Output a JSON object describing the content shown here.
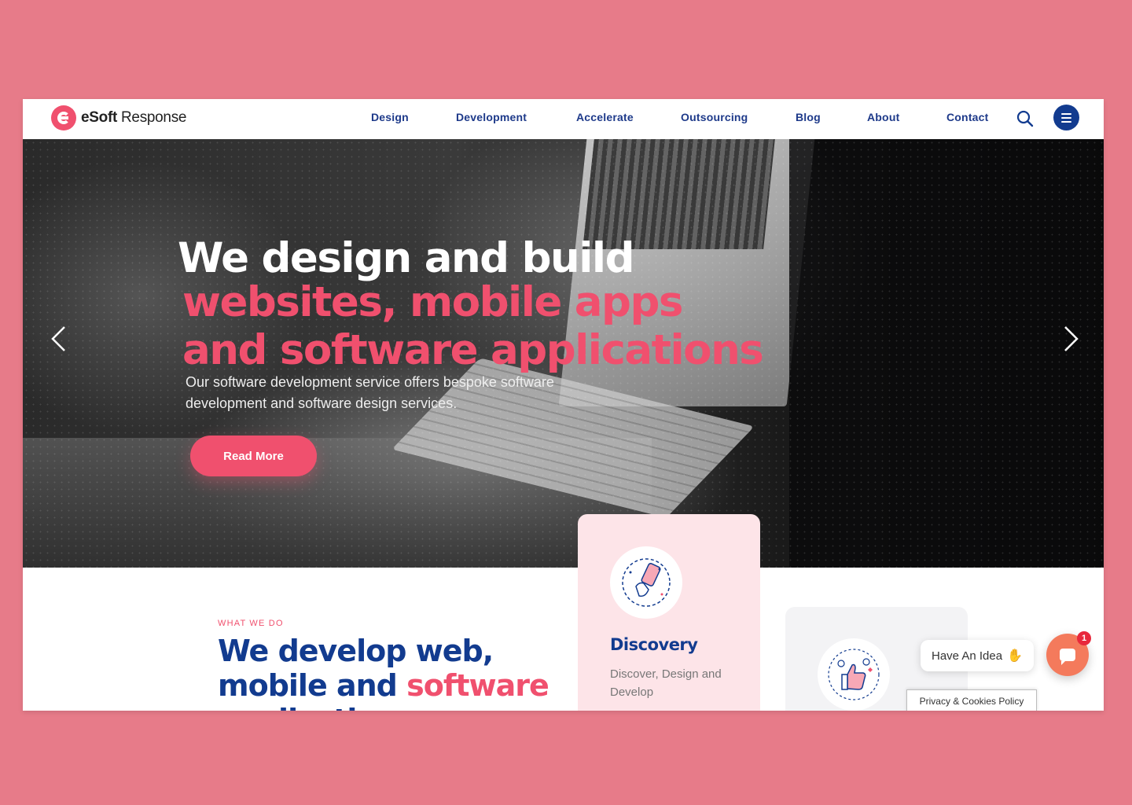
{
  "brand": {
    "logo_bold": "eSoft",
    "logo_light": "Response"
  },
  "nav": {
    "items": [
      {
        "label": "Design"
      },
      {
        "label": "Development"
      },
      {
        "label": "Accelerate"
      },
      {
        "label": "Outsourcing"
      },
      {
        "label": "Blog"
      },
      {
        "label": "About"
      },
      {
        "label": "Contact"
      }
    ],
    "search_icon": "search-icon",
    "menu_icon": "hamburger-icon"
  },
  "hero": {
    "title_line_1": "We design and build",
    "title_line_2": "websites, mobile apps",
    "title_line_3": "and software applications",
    "subtitle": "Our software development service offers bespoke software development and software design services.",
    "cta_label": "Read More",
    "prev_icon": "chevron-left-icon",
    "next_icon": "chevron-right-icon"
  },
  "what_we_do": {
    "eyebrow": "WHAT WE DO",
    "title_part_1": "We develop web, mobile and ",
    "title_accent": "software",
    "title_part_2": " applications"
  },
  "cards": [
    {
      "title": "Discovery",
      "text": "Discover, Design and Develop",
      "icon": "hand-phone-icon"
    },
    {
      "title": "",
      "text": "",
      "icon": "thumbs-up-icon"
    }
  ],
  "chat": {
    "prompt": "Have An Idea",
    "prompt_icon": "waving-hand-icon",
    "badge_count": "1",
    "icon": "chat-icon"
  },
  "privacy_label": "Privacy & Cookies Policy",
  "colors": {
    "background": "#e77b89",
    "brand_pink": "#f0506e",
    "brand_navy": "#123b8f",
    "chat_orange": "#f47a5c"
  }
}
